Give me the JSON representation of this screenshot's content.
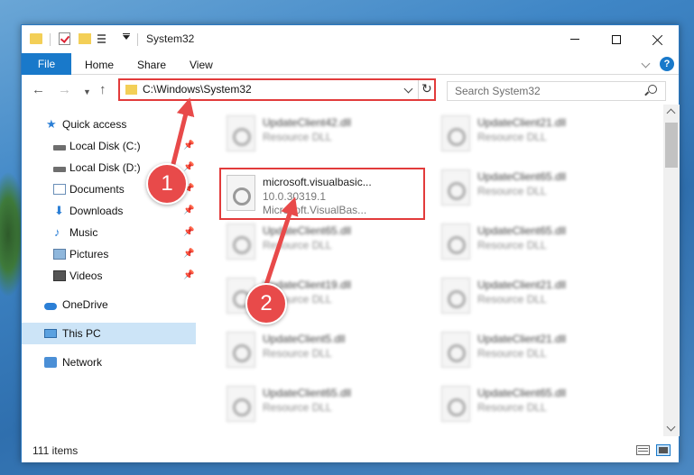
{
  "window": {
    "title": "System32"
  },
  "ribbon": {
    "tabs": [
      "File",
      "Home",
      "Share",
      "View"
    ],
    "help": "?"
  },
  "address": {
    "path": "C:\\Windows\\System32",
    "search_placeholder": "Search System32"
  },
  "nav": {
    "items": [
      {
        "label": "Quick access",
        "icon": "star-icon",
        "pinned": false
      },
      {
        "label": "Local Disk (C:)",
        "icon": "drive-icon",
        "pinned": true
      },
      {
        "label": "Local Disk (D:)",
        "icon": "drive-icon",
        "pinned": true
      },
      {
        "label": "Documents",
        "icon": "documents-icon",
        "pinned": true
      },
      {
        "label": "Downloads",
        "icon": "downloads-icon",
        "pinned": true
      },
      {
        "label": "Music",
        "icon": "music-icon",
        "pinned": true
      },
      {
        "label": "Pictures",
        "icon": "pictures-icon",
        "pinned": true
      },
      {
        "label": "Videos",
        "icon": "videos-icon",
        "pinned": true
      },
      {
        "label": "OneDrive",
        "icon": "onedrive-icon",
        "pinned": false
      },
      {
        "label": "This PC",
        "icon": "pc-icon",
        "pinned": false,
        "selected": true
      },
      {
        "label": "Network",
        "icon": "network-icon",
        "pinned": false
      }
    ]
  },
  "files": {
    "col1": [
      {
        "name": "UpdateClient42.dll",
        "type": "Resource DLL"
      },
      {
        "name": "microsoft.visualbasic...",
        "type": "10.0.30319.1",
        "desc": "Microsoft.VisualBas..."
      },
      {
        "name": "UpdateClient65.dll",
        "type": "Resource DLL"
      },
      {
        "name": "UpdateClient19.dll",
        "type": "Resource DLL"
      },
      {
        "name": "UpdateClient5.dll",
        "type": "Resource DLL"
      },
      {
        "name": "UpdateClient65.dll",
        "type": "Resource DLL"
      }
    ],
    "col2": [
      {
        "name": "UpdateClient21.dll",
        "type": "Resource DLL"
      },
      {
        "name": "UpdateClient65.dll",
        "type": "Resource DLL"
      },
      {
        "name": "UpdateClient65.dll",
        "type": "Resource DLL"
      },
      {
        "name": "UpdateClient21.dll",
        "type": "Resource DLL"
      },
      {
        "name": "UpdateClient21.dll",
        "type": "Resource DLL"
      },
      {
        "name": "UpdateClient65.dll",
        "type": "Resource DLL"
      }
    ]
  },
  "status": {
    "count": "111 items"
  },
  "annotations": {
    "badge1": "1",
    "badge2": "2",
    "color": "#e84a4a"
  }
}
